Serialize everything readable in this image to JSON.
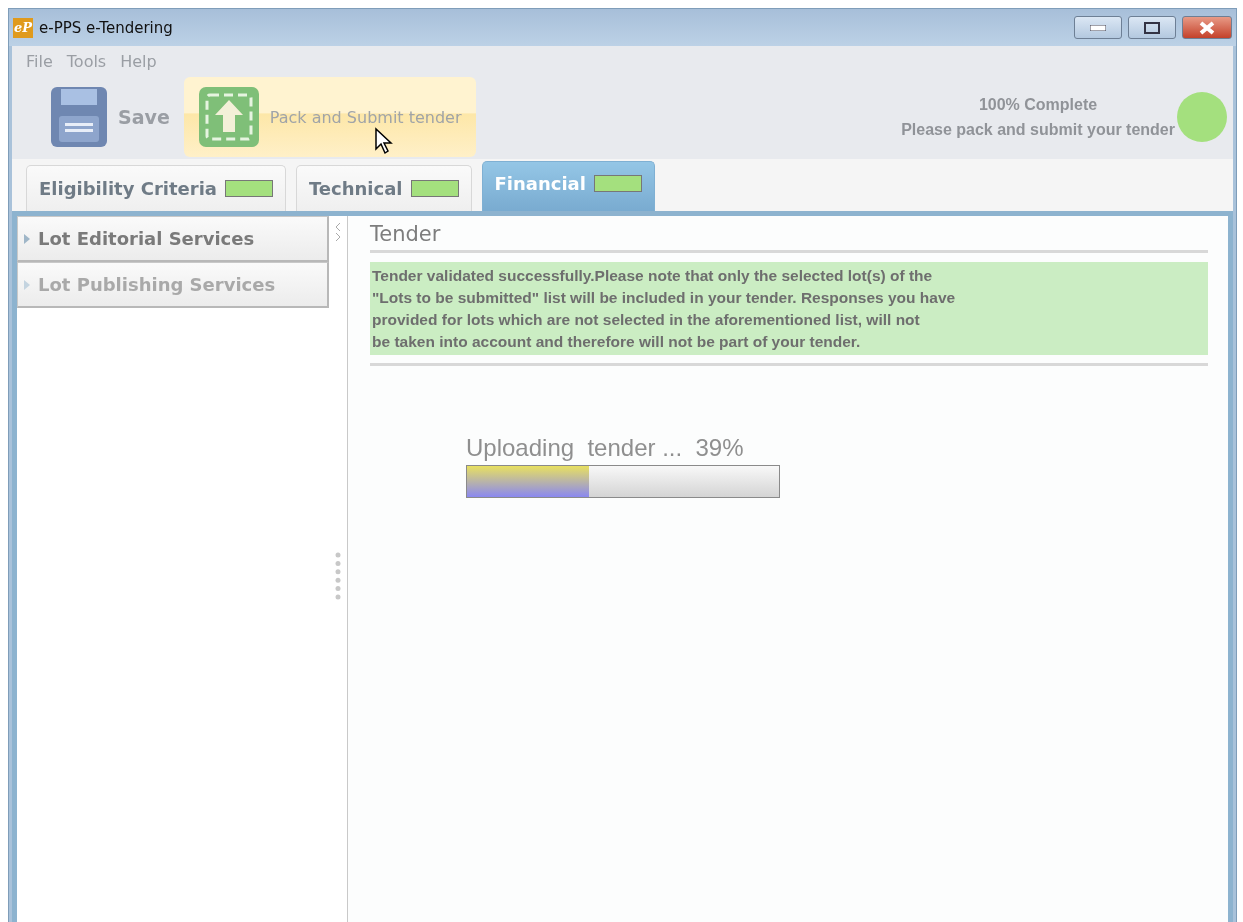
{
  "window": {
    "title": "e-PPS e-Tendering",
    "logo": "eP"
  },
  "menu": [
    "File",
    "Tools",
    "Help"
  ],
  "toolbar": {
    "buttons": [
      {
        "kind": "save",
        "label": "Save",
        "hovered": false
      },
      {
        "kind": "submit",
        "label": "Pack and Submit tender",
        "hovered": true
      }
    ],
    "status": {
      "title": "100% Complete",
      "message": "Please pack and submit your tender"
    }
  },
  "tabs": [
    {
      "label": "Eligibility Criteria",
      "selected": false
    },
    {
      "label": "Technical",
      "selected": false
    },
    {
      "label": "Financial",
      "selected": true
    }
  ],
  "lots": [
    {
      "label": "Lot Editorial Services",
      "disabled": false
    },
    {
      "label": "Lot Publishing Services",
      "disabled": true
    }
  ],
  "panel": {
    "title": "Tender",
    "message": [
      "Tender validated successfully.Please note that only the selected lot(s) of the",
      "\"Lots to be submitted\" list will be included in your tender. Responses you have",
      "provided for lots which are not selected in the aforementioned list, will not",
      "be taken into account and therefore will not be part of your tender."
    ],
    "progress": {
      "label": "Uploading  tender ...  39%",
      "level": 0.39
    }
  }
}
